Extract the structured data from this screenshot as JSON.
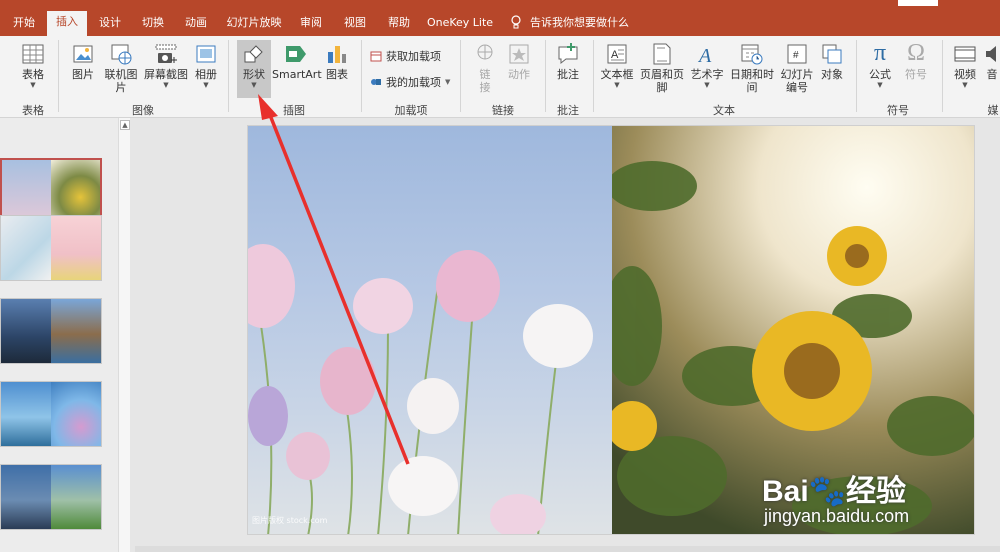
{
  "tabs": [
    "开始",
    "插入",
    "设计",
    "切换",
    "动画",
    "幻灯片放映",
    "审阅",
    "视图",
    "帮助",
    "OneKey Lite"
  ],
  "tell_me": "告诉我你想要做什么",
  "ribbon": {
    "table": "表格",
    "picture": "图片",
    "online_picture": "联机图片",
    "screenshot": "屏幕截图",
    "album": "相册",
    "shapes": "形状",
    "smartart": "SmartArt",
    "chart": "图表",
    "get_addins": "获取加载项",
    "my_addins": "我的加载项",
    "link": "链接",
    "action": "动作",
    "comment": "批注",
    "textbox": "文本框",
    "header_footer": "页眉和页脚",
    "wordart": "艺术字",
    "datetime": "日期和时间",
    "slide_number_1": "幻灯片",
    "slide_number_2": "编号",
    "object": "对象",
    "equation": "公式",
    "symbol": "符号",
    "video": "视频",
    "audio": "音"
  },
  "groups": {
    "tables": "表格",
    "images": "图像",
    "illustrations": "插图",
    "addins": "加载项",
    "links": "链接",
    "comments": "批注",
    "text": "文本",
    "symbols": "符号",
    "media": "媒"
  },
  "slide": {
    "caption": "图片版权 stock.com",
    "wm_logo": "Bai🐾经验",
    "wm_url": "jingyan.baidu.com"
  },
  "colors": {
    "accent": "#b7472a",
    "arrow": "#e8302c"
  }
}
